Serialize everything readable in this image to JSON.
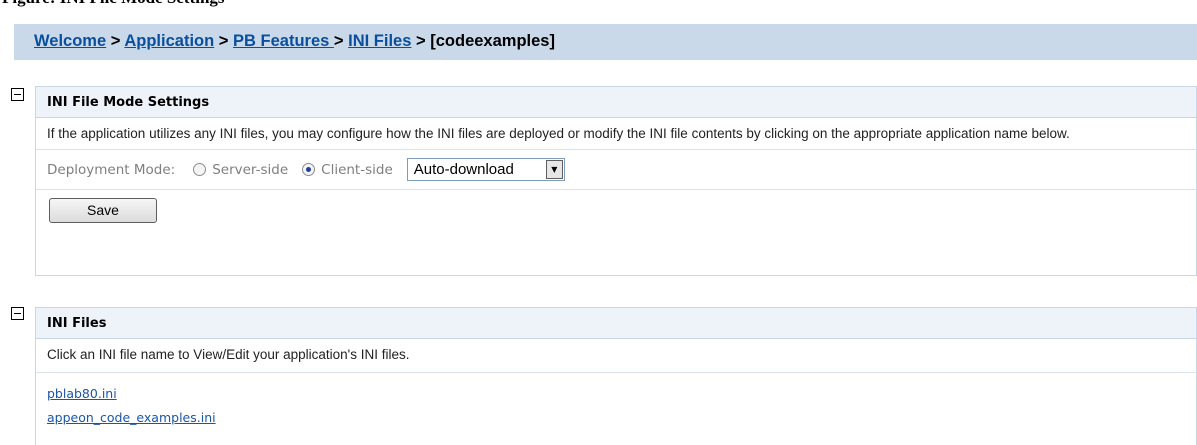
{
  "heading": "Figure: INI File Mode Settings",
  "breadcrumb": {
    "items": [
      "Welcome",
      "Application",
      "PB Features ",
      "INI Files"
    ],
    "separator": ">",
    "current": "[codeexamples]"
  },
  "mode_panel": {
    "title": "INI File Mode Settings",
    "description": "If the application utilizes any INI files, you may configure how the INI files are deployed or modify the INI file contents by clicking on the appropriate application name below.",
    "deployment_label": "Deployment Mode:",
    "options": [
      {
        "label": "Server-side",
        "checked": false
      },
      {
        "label": "Client-side",
        "checked": true
      }
    ],
    "download_select": "Auto-download",
    "save_label": "Save"
  },
  "files_panel": {
    "title": "INI Files",
    "description": "Click an INI file name to View/Edit your application's INI files.",
    "files": [
      "pblab80.ini",
      "appeon_code_examples.ini"
    ]
  },
  "colors": {
    "breadcrumb_bg": "#c9d9ea",
    "link": "#0a4f9e",
    "panel_border": "#c8d6e5",
    "panel_head_bg": "#eef3f9"
  }
}
